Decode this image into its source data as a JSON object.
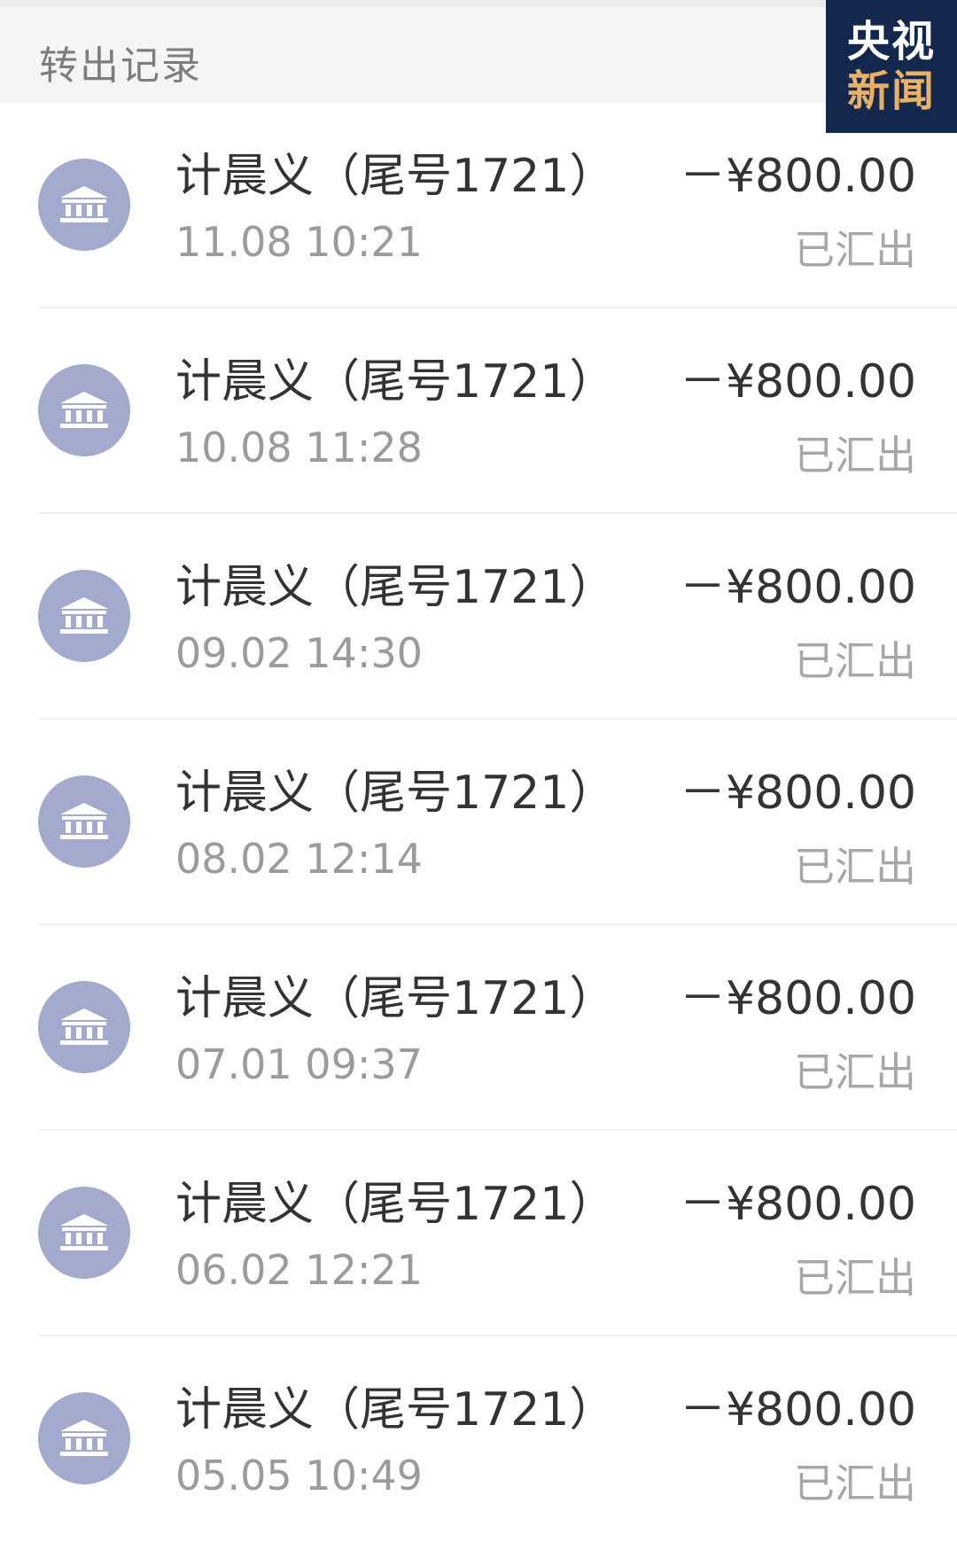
{
  "header": {
    "title": "转出记录"
  },
  "watermark": {
    "line1": "央视",
    "line2": "新闻"
  },
  "colors": {
    "icon_bg": "#a4aacd",
    "watermark_bg": "#14274d",
    "watermark_accent": "#e7b16a"
  },
  "records": [
    {
      "icon": "bank-icon",
      "payee": "计晨义（尾号1721）",
      "amount": "－¥800.00",
      "datetime": "11.08 10:21",
      "status": "已汇出"
    },
    {
      "icon": "bank-icon",
      "payee": "计晨义（尾号1721）",
      "amount": "－¥800.00",
      "datetime": "10.08 11:28",
      "status": "已汇出"
    },
    {
      "icon": "bank-icon",
      "payee": "计晨义（尾号1721）",
      "amount": "－¥800.00",
      "datetime": "09.02 14:30",
      "status": "已汇出"
    },
    {
      "icon": "bank-icon",
      "payee": "计晨义（尾号1721）",
      "amount": "－¥800.00",
      "datetime": "08.02 12:14",
      "status": "已汇出"
    },
    {
      "icon": "bank-icon",
      "payee": "计晨义（尾号1721）",
      "amount": "－¥800.00",
      "datetime": "07.01 09:37",
      "status": "已汇出"
    },
    {
      "icon": "bank-icon",
      "payee": "计晨义（尾号1721）",
      "amount": "－¥800.00",
      "datetime": "06.02 12:21",
      "status": "已汇出"
    },
    {
      "icon": "bank-icon",
      "payee": "计晨义（尾号1721）",
      "amount": "－¥800.00",
      "datetime": "05.05 10:49",
      "status": "已汇出"
    }
  ]
}
